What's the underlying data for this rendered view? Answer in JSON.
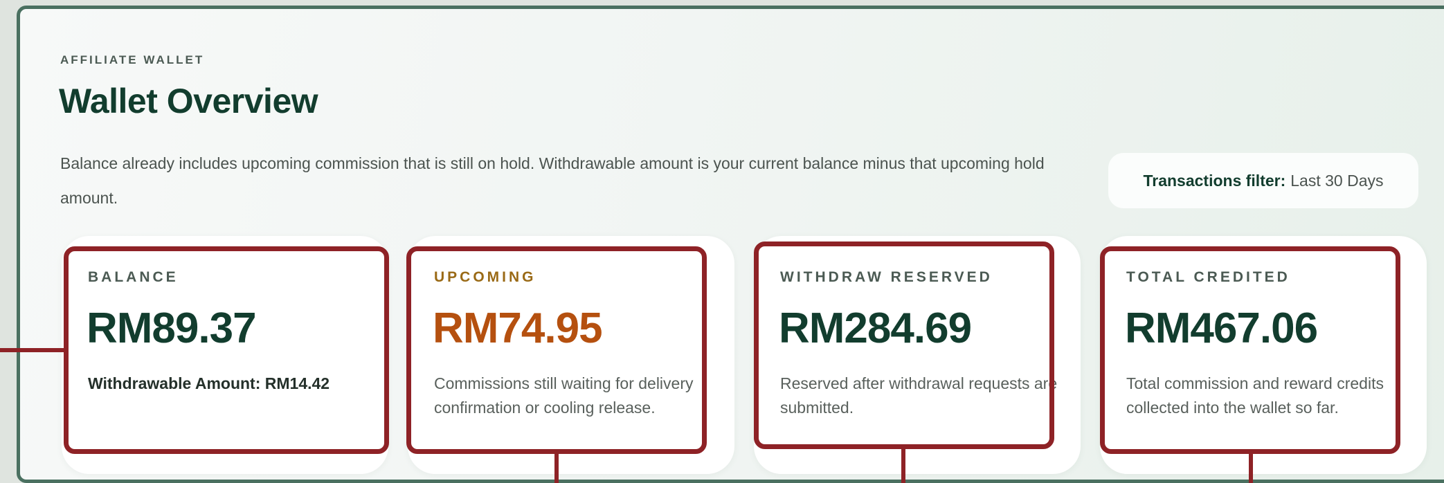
{
  "header": {
    "eyebrow": "AFFILIATE WALLET",
    "title": "Wallet Overview",
    "description": "Balance already includes upcoming commission that is still on hold. Withdrawable amount is your current balance minus that upcoming hold amount."
  },
  "filter": {
    "label": "Transactions filter:",
    "value": "Last 30 Days"
  },
  "cards": [
    {
      "label": "BALANCE",
      "value": "RM89.37",
      "note": "Withdrawable Amount: RM14.42",
      "value_color": "#123d2e",
      "label_color": "#4b5a53"
    },
    {
      "label": "UPCOMING",
      "value": "RM74.95",
      "note": "Commissions still waiting for delivery confirmation or cooling release.",
      "value_color": "#b5500f",
      "label_color": "#9a6a16"
    },
    {
      "label": "WITHDRAW RESERVED",
      "value": "RM284.69",
      "note": "Reserved after withdrawal requests are submitted.",
      "value_color": "#123d2e",
      "label_color": "#4b5a53"
    },
    {
      "label": "TOTAL CREDITED",
      "value": "RM467.06",
      "note": "Total commission and reward credits collected into the wallet so far.",
      "value_color": "#123d2e",
      "label_color": "#4b5a53"
    }
  ],
  "colors": {
    "frame": "#4a7060",
    "highlight": "#8e2226",
    "brand_dark": "#123d2e",
    "upcoming_accent": "#b5500f"
  }
}
